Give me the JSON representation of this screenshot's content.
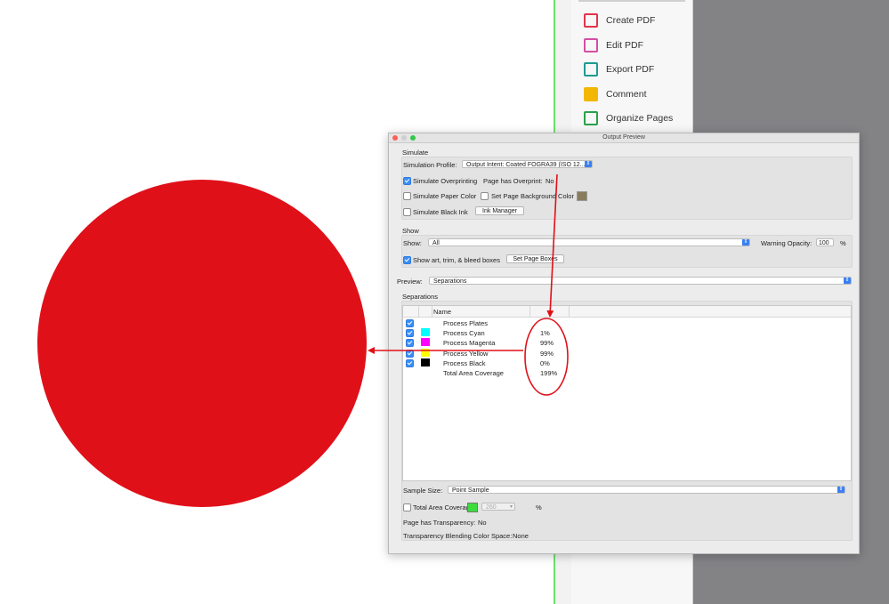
{
  "tools": [
    {
      "label": "Create PDF",
      "icon": "create-pdf-icon",
      "color": "#e3344a"
    },
    {
      "label": "Edit PDF",
      "icon": "edit-pdf-icon",
      "color": "#d44ea5"
    },
    {
      "label": "Export PDF",
      "icon": "export-pdf-icon",
      "color": "#1e9c92"
    },
    {
      "label": "Comment",
      "icon": "comment-icon",
      "color": "#f2b705"
    },
    {
      "label": "Organize Pages",
      "icon": "organize-pages-icon",
      "color": "#2aa14a"
    }
  ],
  "dialog": {
    "title": "Output Preview",
    "simulate": {
      "heading": "Simulate",
      "profile_label": "Simulation Profile:",
      "profile_value": "Output Intent: Coated FOGRA39 (ISO 12...",
      "overprinting_label": "Simulate Overprinting",
      "overprint_label": "Page has Overprint:",
      "overprint_value": "No",
      "paper_color_label": "Simulate Paper Color",
      "bg_color_label": "Set Page Background Color",
      "black_ink_label": "Simulate Black Ink",
      "ink_manager_label": "Ink Manager"
    },
    "show": {
      "heading": "Show",
      "show_label": "Show:",
      "show_value": "All",
      "opacity_label": "Warning Opacity:",
      "opacity_value": "100",
      "opacity_unit": "%",
      "boxes_label": "Show art, trim, & bleed boxes",
      "page_boxes_label": "Set Page Boxes"
    },
    "preview": {
      "label": "Preview:",
      "value": "Separations"
    },
    "separations": {
      "heading": "Separations",
      "col_name": "Name",
      "rows": [
        {
          "name": "Process Plates",
          "value": "",
          "swatch": "",
          "checked": true
        },
        {
          "name": "Process Cyan",
          "value": "1%",
          "swatch": "#00ffff",
          "checked": true
        },
        {
          "name": "Process Magenta",
          "value": "99%",
          "swatch": "#ff00ff",
          "checked": true
        },
        {
          "name": "Process Yellow",
          "value": "99%",
          "swatch": "#ffff00",
          "checked": true
        },
        {
          "name": "Process Black",
          "value": "0%",
          "swatch": "#000000",
          "checked": true
        },
        {
          "name": "Total Area Coverage",
          "value": "199%",
          "swatch": "",
          "checked": false
        }
      ]
    },
    "sample_size_label": "Sample Size:",
    "sample_size_value": "Point Sample",
    "total_area_label": "Total Area Coverage",
    "total_area_value": "260",
    "total_area_unit": "%",
    "transparency_label": "Page has Transparency:",
    "transparency_value": "No",
    "blending_label": "Transparency Blending Color Space:",
    "blending_value": "None"
  },
  "colors": {
    "circle": "#e01019",
    "annotation": "#e01019",
    "accent": "#3a7ff2"
  }
}
